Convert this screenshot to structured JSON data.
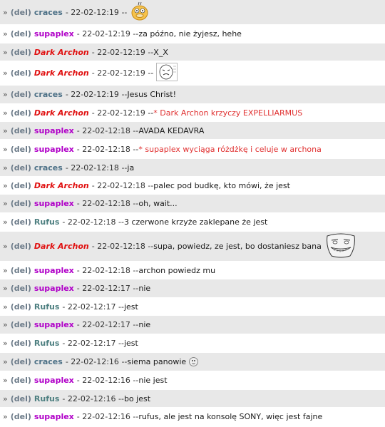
{
  "chat": {
    "messages": [
      {
        "prefix": "»",
        "del": "(del)",
        "user": "craces",
        "user_style": "plain",
        "sep": "-",
        "time": "22-02-12:19",
        "dash": "--",
        "text": "",
        "emote": "psyduck-emote"
      },
      {
        "prefix": "»",
        "del": "(del)",
        "user": "supaplex",
        "user_style": "purple",
        "sep": "-",
        "time": "22-02-12:19",
        "dash": "--",
        "text": "za późno, nie żyjesz, hehe"
      },
      {
        "prefix": "»",
        "del": "(del)",
        "user": "Dark Archon",
        "user_style": "red",
        "sep": "-",
        "time": "22-02-12:19",
        "dash": "--",
        "text": "X_X"
      },
      {
        "prefix": "»",
        "del": "(del)",
        "user": "Dark Archon",
        "user_style": "red",
        "sep": "-",
        "time": "22-02-12:19",
        "dash": "--",
        "text": "",
        "emote": "rage-face-emote"
      },
      {
        "prefix": "»",
        "del": "(del)",
        "user": "craces",
        "user_style": "plain",
        "sep": "-",
        "time": "22-02-12:19",
        "dash": "--",
        "text": "Jesus Christ!"
      },
      {
        "prefix": "»",
        "del": "(del)",
        "user": "Dark Archon",
        "user_style": "red",
        "sep": "-",
        "time": "22-02-12:19",
        "dash": "--",
        "text": "* Dark Archon krzyczy EXPELLIARMUS",
        "action": true
      },
      {
        "prefix": "»",
        "del": "(del)",
        "user": "supaplex",
        "user_style": "purple",
        "sep": "-",
        "time": "22-02-12:18",
        "dash": "--",
        "text": "AVADA KEDAVRA"
      },
      {
        "prefix": "»",
        "del": "(del)",
        "user": "supaplex",
        "user_style": "purple",
        "sep": "-",
        "time": "22-02-12:18",
        "dash": "--",
        "text": "* supaplex wyciąga różdżkę i celuje w archona",
        "action": true
      },
      {
        "prefix": "»",
        "del": "(del)",
        "user": "craces",
        "user_style": "plain",
        "sep": "-",
        "time": "22-02-12:18",
        "dash": "--",
        "text": "ja"
      },
      {
        "prefix": "»",
        "del": "(del)",
        "user": "Dark Archon",
        "user_style": "red",
        "sep": "-",
        "time": "22-02-12:18",
        "dash": "--",
        "text": "palec pod budkę, kto mówi, że jest"
      },
      {
        "prefix": "»",
        "del": "(del)",
        "user": "supaplex",
        "user_style": "purple",
        "sep": "-",
        "time": "22-02-12:18",
        "dash": "--",
        "text": "oh, wait..."
      },
      {
        "prefix": "»",
        "del": "(del)",
        "user": "Rufus",
        "user_style": "teal",
        "sep": "-",
        "time": "22-02-12:18",
        "dash": "--",
        "text": "3 czerwone krzyże zaklepane że jest"
      },
      {
        "prefix": "»",
        "del": "(del)",
        "user": "Dark Archon",
        "user_style": "red",
        "sep": "-",
        "time": "22-02-12:18",
        "dash": "--",
        "text": "supa, powiedz, ze jest, bo dostaniesz bana",
        "emote": "troll-face-emote"
      },
      {
        "prefix": "»",
        "del": "(del)",
        "user": "supaplex",
        "user_style": "purple",
        "sep": "-",
        "time": "22-02-12:18",
        "dash": "--",
        "text": "archon powiedz mu"
      },
      {
        "prefix": "»",
        "del": "(del)",
        "user": "supaplex",
        "user_style": "purple",
        "sep": "-",
        "time": "22-02-12:17",
        "dash": "--",
        "text": "nie"
      },
      {
        "prefix": "»",
        "del": "(del)",
        "user": "Rufus",
        "user_style": "teal",
        "sep": "-",
        "time": "22-02-12:17",
        "dash": "--",
        "text": "jest"
      },
      {
        "prefix": "»",
        "del": "(del)",
        "user": "supaplex",
        "user_style": "purple",
        "sep": "-",
        "time": "22-02-12:17",
        "dash": "--",
        "text": "nie"
      },
      {
        "prefix": "»",
        "del": "(del)",
        "user": "Rufus",
        "user_style": "teal",
        "sep": "-",
        "time": "22-02-12:17",
        "dash": "--",
        "text": "jest"
      },
      {
        "prefix": "»",
        "del": "(del)",
        "user": "craces",
        "user_style": "plain",
        "sep": "-",
        "time": "22-02-12:16",
        "dash": "--",
        "text": "siema panowie",
        "emote": "smiley-emote"
      },
      {
        "prefix": "»",
        "del": "(del)",
        "user": "supaplex",
        "user_style": "purple",
        "sep": "-",
        "time": "22-02-12:16",
        "dash": "--",
        "text": "nie jest"
      },
      {
        "prefix": "»",
        "del": "(del)",
        "user": "Rufus",
        "user_style": "teal",
        "sep": "-",
        "time": "22-02-12:16",
        "dash": "--",
        "text": "bo jest"
      },
      {
        "prefix": "»",
        "del": "(del)",
        "user": "supaplex",
        "user_style": "purple",
        "sep": "-",
        "time": "22-02-12:16",
        "dash": "--",
        "text": "rufus, ale jest na konsolę SONY, więc jest fajne"
      }
    ]
  },
  "colors": {
    "row_even": "#e8e8e8",
    "row_odd": "#ffffff",
    "user_purple": "#b000c8",
    "user_red": "#e01010",
    "user_teal": "#4d7f80",
    "user_plain": "#4c7086",
    "action_text": "#e03030"
  }
}
